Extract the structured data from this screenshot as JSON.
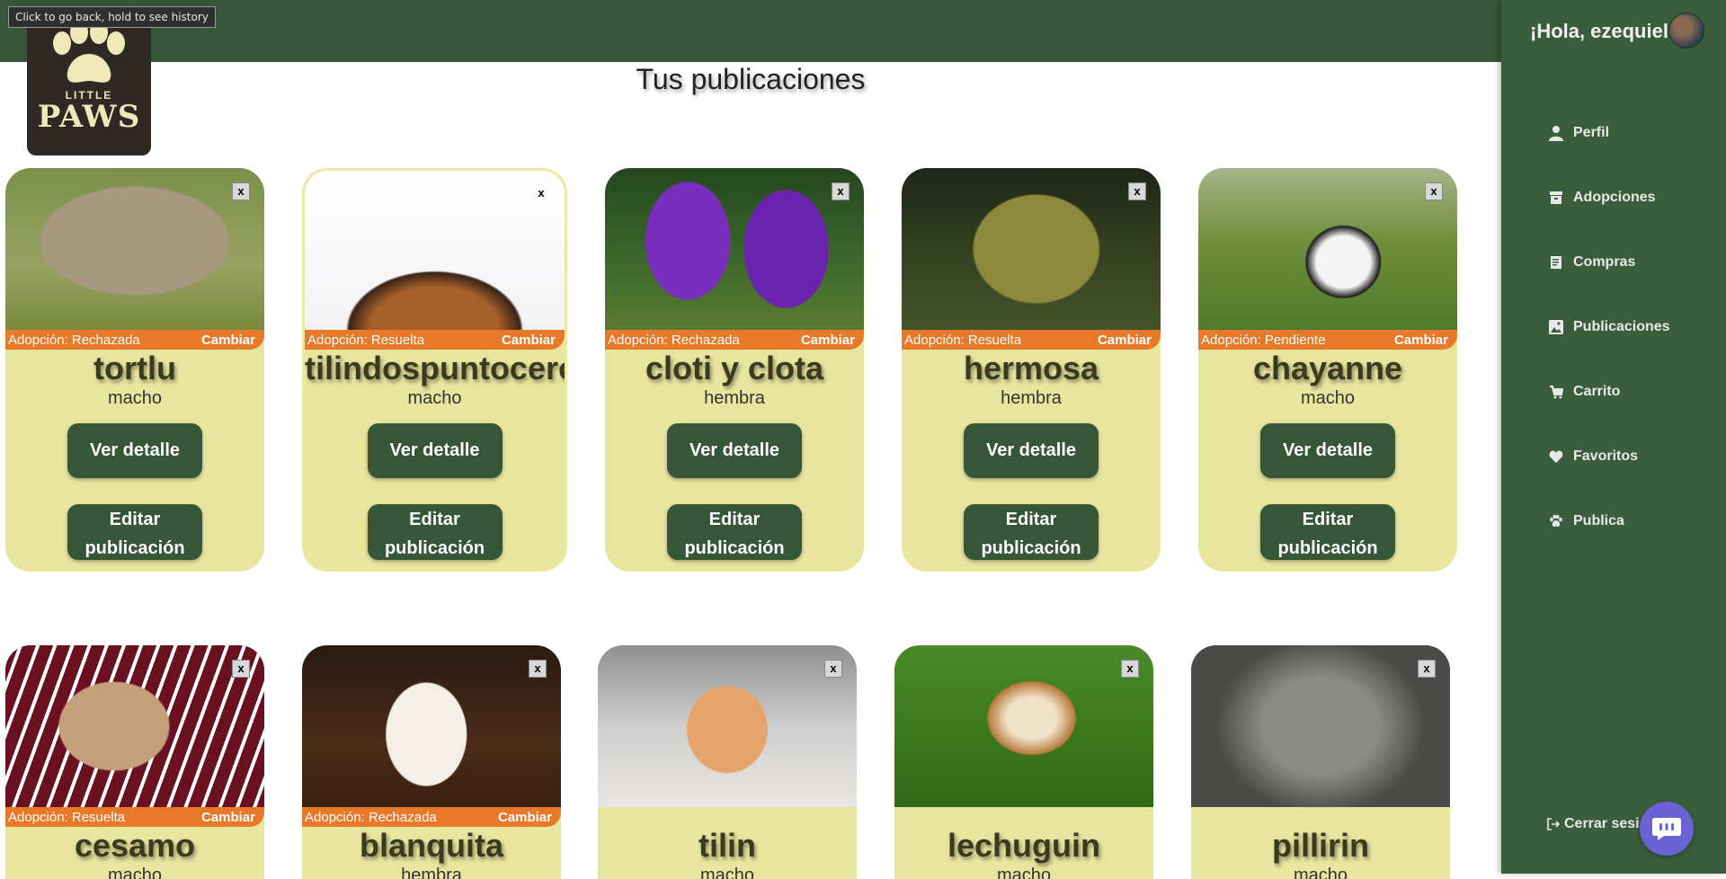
{
  "browser": {
    "tooltip": "Click to go back, hold to see history"
  },
  "brand": {
    "logo_top": "LITTLE",
    "logo_bottom": "PAWS"
  },
  "page": {
    "title": "Tus publicaciones"
  },
  "sidebar": {
    "greeting_prefix": "¡Hola,",
    "user_name": "ezequiel",
    "items": [
      {
        "label": "Perfil",
        "icon": "user-icon"
      },
      {
        "label": "Adopciones",
        "icon": "box-icon"
      },
      {
        "label": "Compras",
        "icon": "receipt-icon"
      },
      {
        "label": "Publicaciones",
        "icon": "image-icon"
      },
      {
        "label": "Carrito",
        "icon": "cart-icon"
      },
      {
        "label": "Favoritos",
        "icon": "heart-icon"
      },
      {
        "label": "Publica",
        "icon": "paw-icon"
      }
    ],
    "logout": "Cerrar sesi"
  },
  "cards": {
    "close_label": "x",
    "change_label": "Cambiar",
    "detail_label": "Ver detalle",
    "edit_label": "Editar publicación",
    "items": [
      {
        "name": "tortlu",
        "sex": "macho",
        "status": "Adopción: Rechazada"
      },
      {
        "name": "tilindospuntocero",
        "sex": "macho",
        "status": "Adopción: Resuelta"
      },
      {
        "name": "cloti y clota",
        "sex": "hembra",
        "status": "Adopción: Rechazada"
      },
      {
        "name": "hermosa",
        "sex": "hembra",
        "status": "Adopción: Resuelta"
      },
      {
        "name": "chayanne",
        "sex": "macho",
        "status": "Adopción: Pendiente"
      },
      {
        "name": "cesamo",
        "sex": "macho",
        "status": "Adopción: Resuelta"
      },
      {
        "name": "blanquita",
        "sex": "hembra",
        "status": "Adopción: Rechazada"
      },
      {
        "name": "tilin",
        "sex": "macho",
        "status": ""
      },
      {
        "name": "lechuguin",
        "sex": "macho",
        "status": ""
      },
      {
        "name": "pillirin",
        "sex": "macho",
        "status": ""
      }
    ]
  },
  "colors": {
    "header": "#355737",
    "sidebar": "#3a5e3c",
    "card": "#e8e59f",
    "status": "#e8792b",
    "button": "#355737",
    "chat": "#6a63d6"
  }
}
